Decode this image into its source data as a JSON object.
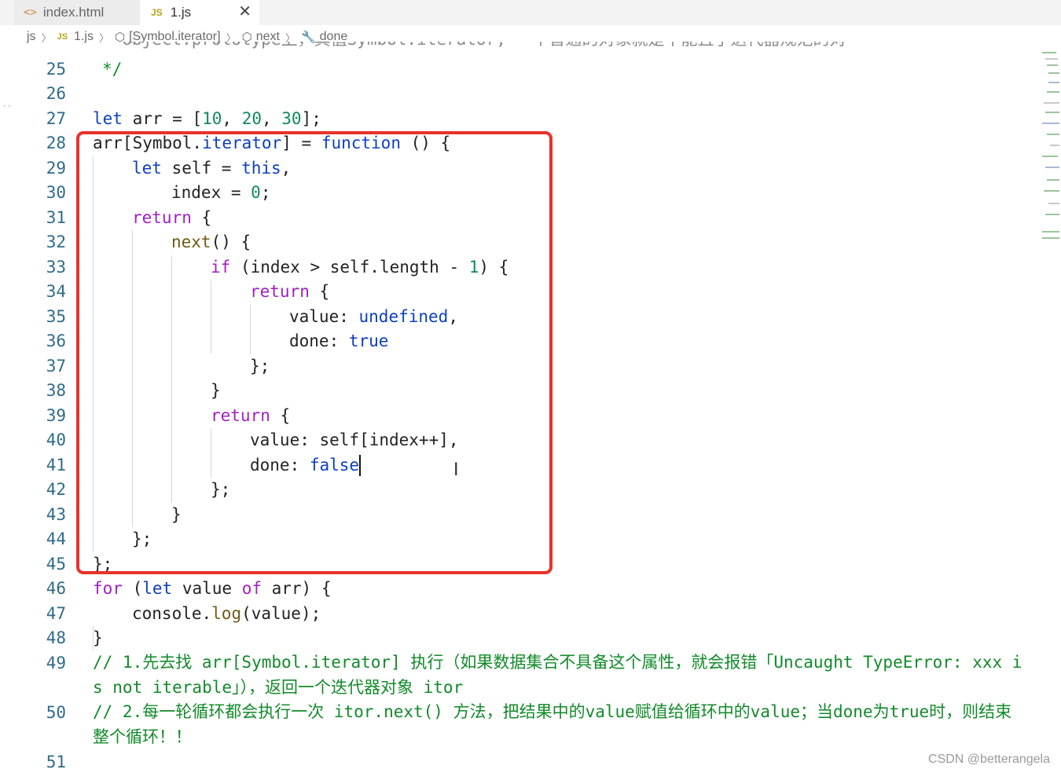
{
  "tabs": [
    {
      "icon": "<>",
      "label": "index.html"
    },
    {
      "icon": "JS",
      "label": "1.js",
      "close": "✕"
    }
  ],
  "breadcrumb": {
    "folder": "js",
    "file_icon": "JS",
    "file": "1.js",
    "symbol": "[Symbol.iterator]",
    "method": "next",
    "property": "done"
  },
  "cut_line_text": "  Object.prototype上，其值Symbol.iterator, 一个普通的对象就是不能且了迭代器规范的对",
  "line_numbers": [
    "25",
    "26",
    "27",
    "28",
    "29",
    "30",
    "31",
    "32",
    "33",
    "34",
    "35",
    "36",
    "37",
    "38",
    "39",
    "40",
    "41",
    "42",
    "43",
    "44",
    "45",
    "46",
    "47",
    "48",
    "49",
    "50",
    "51"
  ],
  "code": {
    "l25": "*/",
    "l27": [
      "let",
      " arr = [",
      "10",
      ", ",
      "20",
      ", ",
      "30",
      "];"
    ],
    "l28": [
      "arr[Symbol.",
      "iterator",
      "] = ",
      "function",
      " () {"
    ],
    "l29": [
      "let",
      " self = ",
      "this",
      ","
    ],
    "l30": [
      "index = ",
      "0",
      ";"
    ],
    "l31": [
      "return",
      " {"
    ],
    "l32": [
      "next",
      "() {"
    ],
    "l33": [
      "if",
      " (index > self.length - ",
      "1",
      ") {"
    ],
    "l34": [
      "return",
      " {"
    ],
    "l35": [
      "value: ",
      "undefined",
      ","
    ],
    "l36": [
      "done: ",
      "true"
    ],
    "l37": "};",
    "l38": "}",
    "l39": [
      "return",
      " {"
    ],
    "l40": "value: self[index++],",
    "l41": [
      "done: ",
      "false"
    ],
    "l42": "};",
    "l43": "}",
    "l44": "};",
    "l45": "};",
    "l46": [
      "for",
      " (",
      "let",
      " value ",
      "of",
      " arr) {"
    ],
    "l47": [
      "console.",
      "log",
      "(value);"
    ],
    "l48": "}",
    "l49": "// 1.先去找 arr[Symbol.iterator] 执行（如果数据集合不具备这个属性，就会报错「Uncaught TypeError: xxx is not iterable」），返回一个迭代器对象 itor",
    "l50": "// 2.每一轮循环都会执行一次  itor.next() 方法，把结果中的value赋值给循环中的value；当done为true时，则结束整个循环！！"
  },
  "colors": {
    "highlight_border": "#e8322a",
    "keyword": "#0c3fbf",
    "control_keyword": "#a020c0",
    "number": "#118a5a",
    "comment": "#128a2a",
    "line_number": "#2e6b8a"
  },
  "watermark": "CSDN @betterangela"
}
